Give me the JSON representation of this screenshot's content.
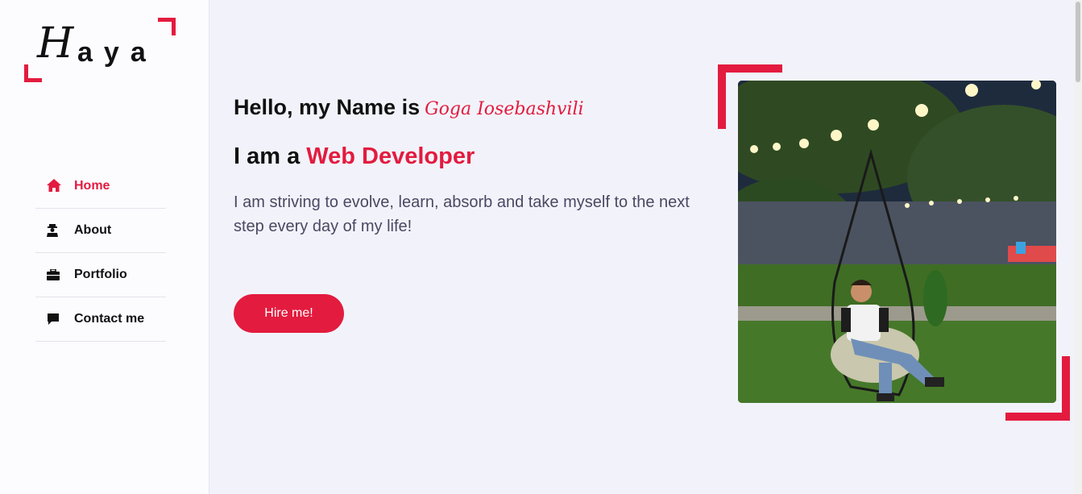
{
  "logo": {
    "first_letter": "H",
    "rest": "aya"
  },
  "nav": [
    {
      "label": "Home",
      "icon": "home-icon",
      "active": true
    },
    {
      "label": "About",
      "icon": "user-icon",
      "active": false
    },
    {
      "label": "Portfolio",
      "icon": "briefcase-icon",
      "active": false
    },
    {
      "label": "Contact me",
      "icon": "comment-icon",
      "active": false
    }
  ],
  "hero": {
    "hello_prefix": "Hello, my Name is",
    "name": "Goga Iosebashvili",
    "iam_prefix": "I am a",
    "role": "Web Developer",
    "tagline": "I am striving to evolve, learn, absorb and take myself to the next step every day of my life!",
    "cta_label": "Hire me!"
  },
  "colors": {
    "accent": "#e31b3f",
    "background": "#f2f3fa",
    "sidebar": "#fcfbfe"
  }
}
